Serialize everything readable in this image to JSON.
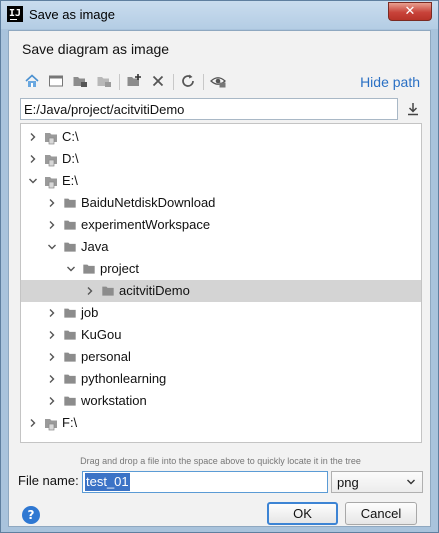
{
  "window": {
    "title": "Save as image",
    "close_glyph": "✕",
    "app_icon_text": "IJ"
  },
  "dialog": {
    "heading": "Save diagram as image"
  },
  "toolbar": {
    "buttons": [
      "home-icon",
      "desktop-icon",
      "project-icon",
      "module-icon",
      "new-folder-icon",
      "delete-icon",
      "refresh-icon",
      "show-hidden-icon"
    ],
    "hide_path_label": "Hide path"
  },
  "path": {
    "value": "E:/Java/project/acitvitiDemo"
  },
  "tree": {
    "items": [
      {
        "label": "C:\\",
        "depth": 0,
        "expanded": false,
        "kind": "drive"
      },
      {
        "label": "D:\\",
        "depth": 0,
        "expanded": false,
        "kind": "drive"
      },
      {
        "label": "E:\\",
        "depth": 0,
        "expanded": true,
        "kind": "drive"
      },
      {
        "label": "BaiduNetdiskDownload",
        "depth": 1,
        "expanded": false,
        "kind": "folder"
      },
      {
        "label": "experimentWorkspace",
        "depth": 1,
        "expanded": false,
        "kind": "folder"
      },
      {
        "label": "Java",
        "depth": 1,
        "expanded": true,
        "kind": "folder"
      },
      {
        "label": "project",
        "depth": 2,
        "expanded": true,
        "kind": "folder"
      },
      {
        "label": "acitvitiDemo",
        "depth": 3,
        "expanded": false,
        "kind": "folder",
        "selected": true
      },
      {
        "label": "job",
        "depth": 1,
        "expanded": false,
        "kind": "folder"
      },
      {
        "label": "KuGou",
        "depth": 1,
        "expanded": false,
        "kind": "folder"
      },
      {
        "label": "personal",
        "depth": 1,
        "expanded": false,
        "kind": "folder"
      },
      {
        "label": "pythonlearning",
        "depth": 1,
        "expanded": false,
        "kind": "folder"
      },
      {
        "label": "workstation",
        "depth": 1,
        "expanded": false,
        "kind": "folder"
      },
      {
        "label": "F:\\",
        "depth": 0,
        "expanded": false,
        "kind": "drive"
      }
    ]
  },
  "hint": "Drag and drop a file into the space above to quickly locate it in the tree",
  "file": {
    "label": "File name:",
    "value": "test_01"
  },
  "format": {
    "value": "png"
  },
  "buttons": {
    "ok": "OK",
    "cancel": "Cancel",
    "help": "?"
  },
  "colors": {
    "accent": "#2a70c4",
    "selection": "#d4d4d4",
    "titlebar": "#b4cde4"
  }
}
